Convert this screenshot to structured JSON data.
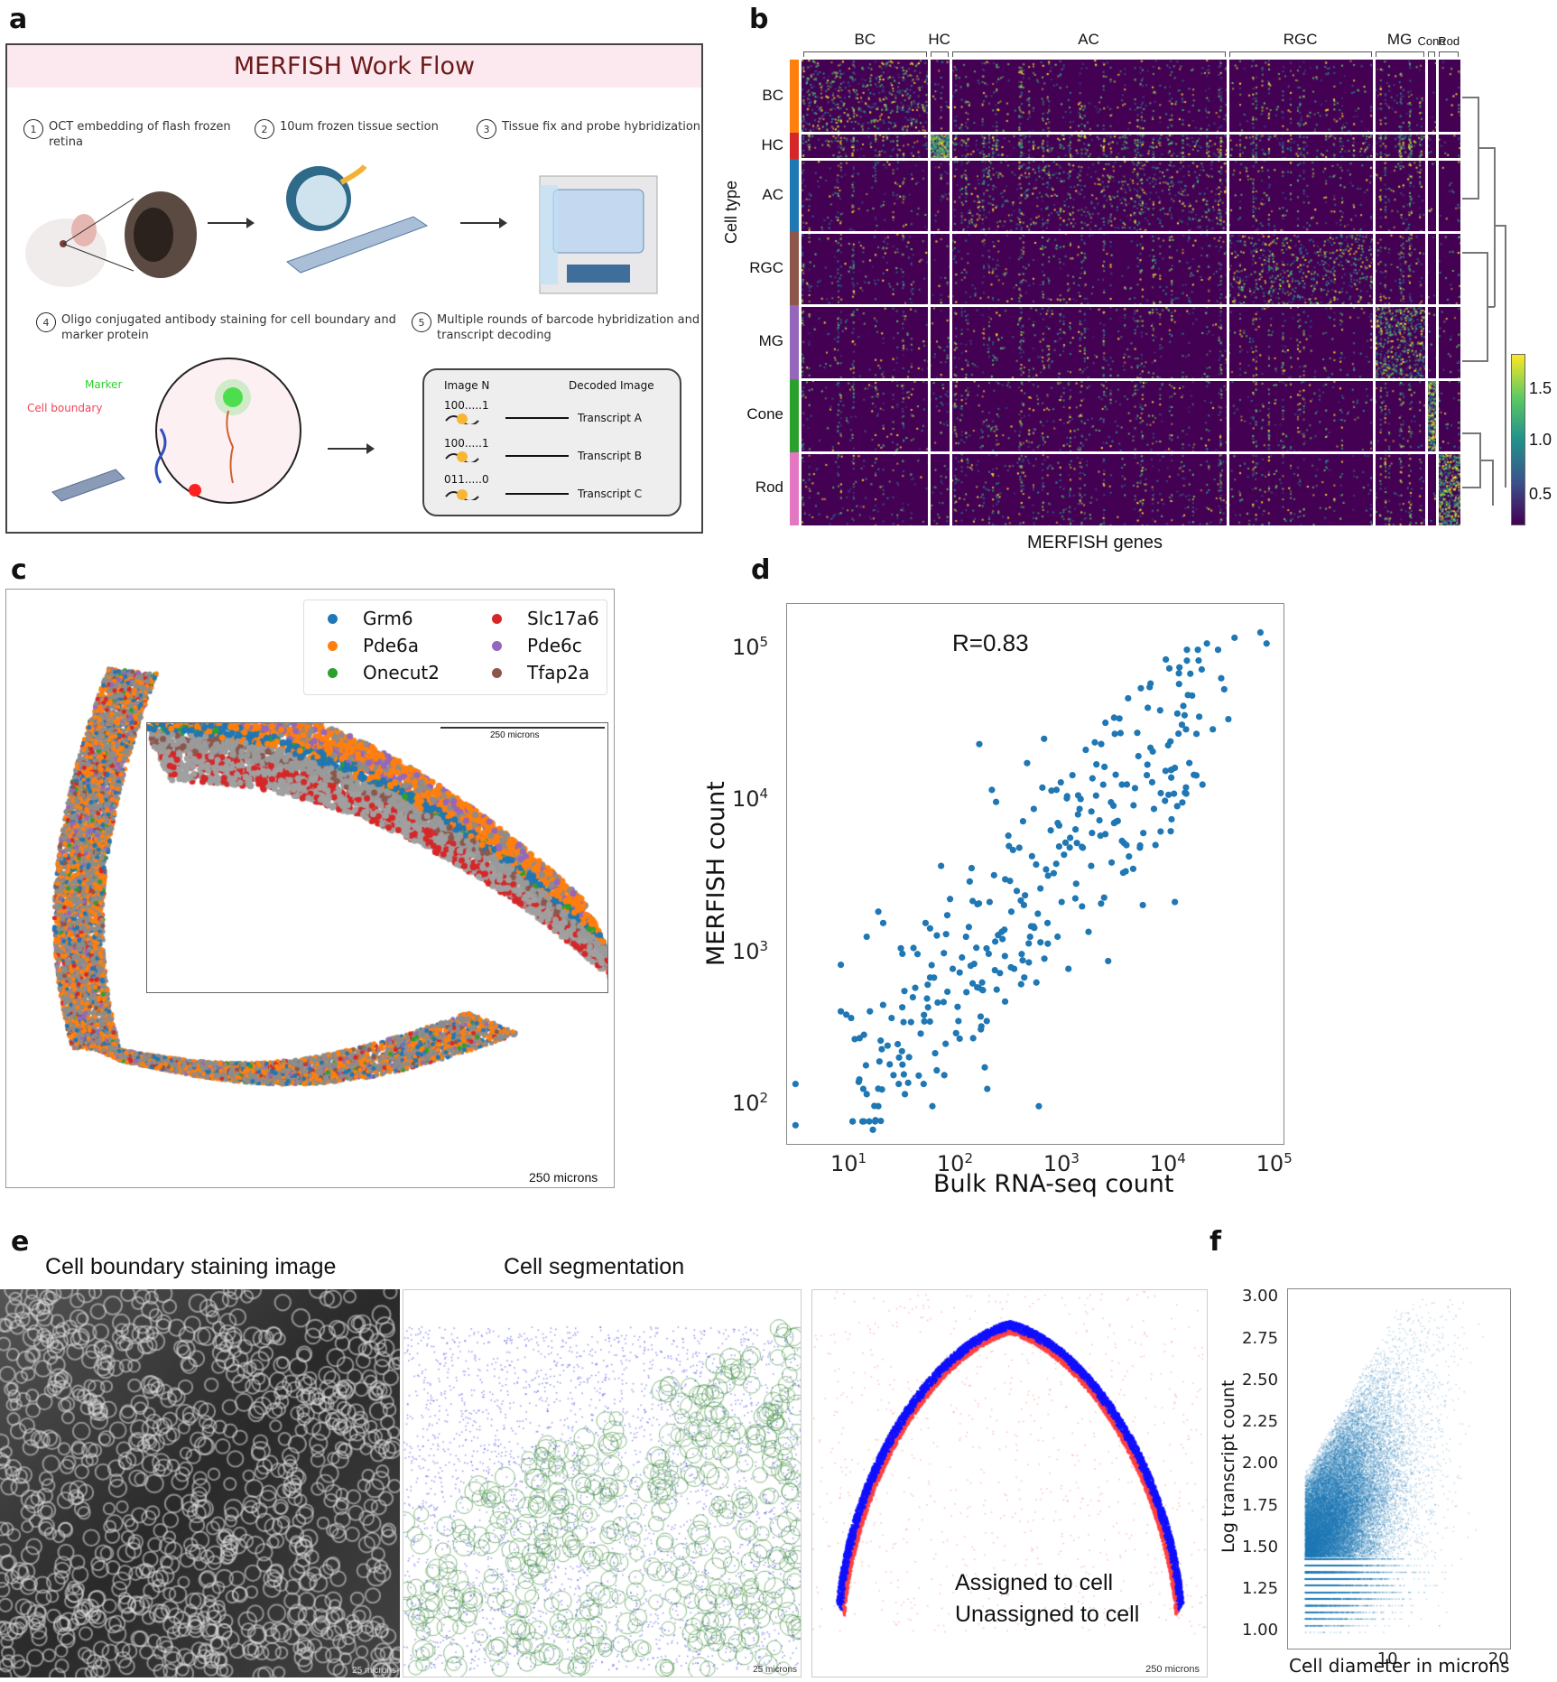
{
  "panel_labels": {
    "a": "a",
    "b": "b",
    "c": "c",
    "d": "d",
    "e": "e",
    "f": "f"
  },
  "panel_a": {
    "title": "MERFISH Work Flow",
    "steps": [
      {
        "num": "1",
        "text": "OCT embedding of flash frozen retina"
      },
      {
        "num": "2",
        "text": "10um frozen tissue section"
      },
      {
        "num": "3",
        "text": "Tissue fix and probe hybridization"
      },
      {
        "num": "4",
        "text": "Oligo conjugated antibody staining for cell boundary and marker protein"
      },
      {
        "num": "5",
        "text": "Multiple rounds of barcode hybridization and transcript decoding"
      }
    ],
    "labels": {
      "marker": "Marker",
      "cell_boundary": "Cell boundary"
    },
    "decode": {
      "col1": "Image N",
      "col2": "Decoded Image",
      "rows": [
        {
          "code": "100.....1",
          "transcript": "Transcript A"
        },
        {
          "code": "100.....1",
          "transcript": "Transcript B"
        },
        {
          "code": "011.....0",
          "transcript": "Transcript C"
        }
      ]
    }
  },
  "panel_b": {
    "ylabel": "Cell type",
    "xlabel": "MERFISH genes",
    "column_groups": [
      "BC",
      "HC",
      "AC",
      "RGC",
      "MG",
      "Cone",
      "Rod"
    ],
    "column_group_fractions": [
      0.165,
      0.028,
      0.36,
      0.19,
      0.068,
      0.015,
      0.03
    ],
    "row_labels": [
      "BC",
      "HC",
      "AC",
      "RGC",
      "MG",
      "Cone",
      "Rod"
    ],
    "row_fractions": [
      0.14,
      0.05,
      0.14,
      0.14,
      0.14,
      0.14,
      0.14
    ],
    "row_colors": [
      "#ff7f0e",
      "#d62728",
      "#1f77b4",
      "#8c564b",
      "#9467bd",
      "#2ca02c",
      "#e377c2"
    ],
    "colorbar_ticks": [
      "1.5",
      "1.0",
      "0.5"
    ],
    "colorbar_range": [
      0.1,
      1.8
    ]
  },
  "panel_c": {
    "legend": [
      {
        "name": "Grm6",
        "color": "#1f77b4"
      },
      {
        "name": "Slc17a6",
        "color": "#d62728"
      },
      {
        "name": "Pde6a",
        "color": "#ff7f0e"
      },
      {
        "name": "Pde6c",
        "color": "#9467bd"
      },
      {
        "name": "Onecut2",
        "color": "#2ca02c"
      },
      {
        "name": "Tfap2a",
        "color": "#8c564b"
      }
    ],
    "inset_scalebar": "250 microns",
    "scalebar": "250 microns"
  },
  "chart_data": [
    {
      "type": "scatter",
      "id": "panel-d",
      "title": "",
      "annotation": "R=0.83",
      "xlabel": "Bulk RNA-seq count",
      "ylabel": "MERFISH count",
      "xscale": "log",
      "yscale": "log",
      "xlim": [
        2.5,
        120000
      ],
      "ylim": [
        55,
        200000
      ],
      "xticks": [
        {
          "base": "10",
          "exp": "1",
          "v": 10
        },
        {
          "base": "10",
          "exp": "2",
          "v": 100
        },
        {
          "base": "10",
          "exp": "3",
          "v": 1000
        },
        {
          "base": "10",
          "exp": "4",
          "v": 10000
        },
        {
          "base": "10",
          "exp": "5",
          "v": 100000
        }
      ],
      "yticks": [
        {
          "base": "10",
          "exp": "2",
          "v": 100
        },
        {
          "base": "10",
          "exp": "3",
          "v": 1000
        },
        {
          "base": "10",
          "exp": "4",
          "v": 10000
        },
        {
          "base": "10",
          "exp": "5",
          "v": 100000
        }
      ],
      "color": "#1f77b4",
      "points_summary": "~350 genes; log-log correlation R=0.83",
      "sample_points": [
        [
          3,
          140
        ],
        [
          3,
          75
        ],
        [
          8,
          850
        ],
        [
          8,
          420
        ],
        [
          9,
          400
        ],
        [
          10,
          380
        ],
        [
          12,
          280
        ],
        [
          13,
          130
        ],
        [
          14,
          120
        ],
        [
          14,
          1300
        ],
        [
          15,
          420
        ],
        [
          16,
          70
        ],
        [
          18,
          1900
        ],
        [
          18,
          100
        ],
        [
          19,
          80
        ],
        [
          20,
          1600
        ],
        [
          22,
          250
        ],
        [
          24,
          380
        ],
        [
          25,
          160
        ],
        [
          28,
          140
        ],
        [
          30,
          230
        ],
        [
          32,
          120
        ],
        [
          35,
          210
        ],
        [
          38,
          520
        ],
        [
          40,
          600
        ],
        [
          42,
          1000
        ],
        [
          45,
          300
        ],
        [
          48,
          140
        ],
        [
          50,
          1600
        ],
        [
          55,
          360
        ],
        [
          58,
          100
        ],
        [
          60,
          700
        ],
        [
          65,
          480
        ],
        [
          70,
          3800
        ],
        [
          75,
          160
        ],
        [
          80,
          1800
        ],
        [
          85,
          2300
        ],
        [
          90,
          800
        ],
        [
          100,
          450
        ],
        [
          110,
          950
        ],
        [
          120,
          1300
        ],
        [
          130,
          3000
        ],
        [
          140,
          280
        ],
        [
          150,
          1100
        ],
        [
          160,
          24000
        ],
        [
          170,
          650
        ],
        [
          180,
          180
        ],
        [
          190,
          130
        ],
        [
          200,
          2200
        ],
        [
          210,
          12000
        ],
        [
          220,
          3300
        ],
        [
          230,
          10000
        ],
        [
          250,
          750
        ],
        [
          260,
          1400
        ],
        [
          280,
          3100
        ],
        [
          300,
          6000
        ],
        [
          320,
          1900
        ],
        [
          340,
          800
        ],
        [
          360,
          2600
        ],
        [
          380,
          5000
        ],
        [
          400,
          1000
        ],
        [
          420,
          2100
        ],
        [
          450,
          18000
        ],
        [
          480,
          1300
        ],
        [
          500,
          4400
        ],
        [
          520,
          9000
        ],
        [
          550,
          650
        ],
        [
          580,
          100
        ],
        [
          600,
          2700
        ],
        [
          650,
          26000
        ],
        [
          700,
          1600
        ],
        [
          750,
          6500
        ],
        [
          800,
          3400
        ],
        [
          850,
          12000
        ],
        [
          900,
          7000
        ],
        [
          950,
          2200
        ],
        [
          1000,
          4500
        ],
        [
          1100,
          800
        ],
        [
          1200,
          15000
        ],
        [
          1300,
          2900
        ],
        [
          1400,
          9000
        ],
        [
          1500,
          5000
        ],
        [
          1600,
          22000
        ],
        [
          1700,
          1400
        ],
        [
          1800,
          3800
        ],
        [
          2000,
          11000
        ],
        [
          2200,
          6000
        ],
        [
          2400,
          17000
        ],
        [
          2600,
          900
        ],
        [
          2800,
          4000
        ],
        [
          3000,
          28000
        ],
        [
          3200,
          7500
        ],
        [
          3500,
          13000
        ],
        [
          3800,
          3500
        ],
        [
          4000,
          48000
        ],
        [
          4500,
          9500
        ],
        [
          5000,
          20000
        ],
        [
          5500,
          2100
        ],
        [
          6000,
          15000
        ],
        [
          6500,
          60000
        ],
        [
          7000,
          9000
        ],
        [
          8000,
          40000
        ],
        [
          9000,
          16000
        ],
        [
          10000,
          25000
        ],
        [
          11000,
          2200
        ],
        [
          12000,
          70000
        ],
        [
          14000,
          30000
        ],
        [
          16000,
          50000
        ],
        [
          20000,
          13000
        ],
        [
          22000,
          110000
        ],
        [
          25000,
          30000
        ],
        [
          28000,
          100000
        ],
        [
          30000,
          65000
        ],
        [
          32000,
          55000
        ],
        [
          35000,
          35000
        ],
        [
          40000,
          120000
        ],
        [
          70000,
          130000
        ],
        [
          80000,
          110000
        ]
      ]
    },
    {
      "type": "scatter",
      "id": "panel-f",
      "xlabel": "Cell diameter in microns",
      "ylabel": "Log transcript count",
      "xlim": [
        1,
        21
      ],
      "ylim": [
        0.9,
        3.05
      ],
      "xticks": [
        "10",
        "20"
      ],
      "yticks": [
        "1.00",
        "1.25",
        "1.50",
        "1.75",
        "2.00",
        "2.25",
        "2.50",
        "2.75",
        "3.00"
      ],
      "color": "#1f77b4",
      "points_summary": "dense cloud, x≈2–20, y≈1.0–3.0; quantized horizontal bands below y≈1.45"
    }
  ],
  "panel_e": {
    "titles": [
      "Cell boundary staining image",
      "Cell segmentation"
    ],
    "scalebars": [
      "25 microns",
      "25 microns",
      "250 microns"
    ],
    "legend": [
      {
        "text": "Assigned to cell",
        "color": "#2b4aa8"
      },
      {
        "text": "Unassigned to cell",
        "color": "#cc0000"
      }
    ]
  }
}
